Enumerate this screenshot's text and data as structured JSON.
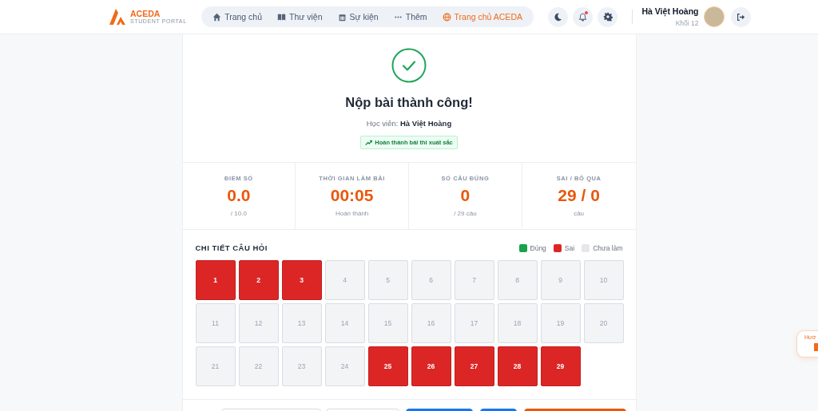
{
  "header": {
    "brand": "ACEDA",
    "subtitle": "STUDENT PORTAL",
    "nav": [
      {
        "label": "Trang chủ",
        "kind": "home",
        "selected": false
      },
      {
        "label": "Thư viện",
        "kind": "book",
        "selected": false
      },
      {
        "label": "Sự kiện",
        "kind": "calendar",
        "selected": false
      },
      {
        "label": "Thêm",
        "kind": "dots",
        "selected": false
      },
      {
        "label": "Trang chủ ACEDA",
        "kind": "globe",
        "selected": true
      }
    ],
    "notification_dot": true,
    "user": {
      "name": "Hà Việt Hoàng",
      "grade": "Khối 12"
    }
  },
  "result": {
    "title": "Nộp bài thành công!",
    "student_label": "Học viên:",
    "student_name": "Hà Việt Hoàng",
    "badge": "Hoàn thành bài thi xuất sắc"
  },
  "stats": [
    {
      "label": "ĐIỂM SỐ",
      "value": "0.0",
      "note": "/ 10.0"
    },
    {
      "label": "THỜI GIAN LÀM BÀI",
      "value": "00:05",
      "note": "Hoàn thành"
    },
    {
      "label": "SỐ CÂU ĐÚNG",
      "value": "0",
      "note": "/ 29 câu"
    },
    {
      "label": "SAI / BỎ QUA",
      "value": "29 / 0",
      "note": "câu"
    }
  ],
  "details": {
    "title": "CHI TIẾT CÂU HỎI",
    "legend": [
      {
        "label": "Đúng",
        "color": "#16a34a"
      },
      {
        "label": "Sai",
        "color": "#dc2626"
      },
      {
        "label": "Chưa làm",
        "color": "#e5e7eb"
      }
    ],
    "questions": [
      {
        "number": "1",
        "kind": "wrong"
      },
      {
        "number": "2",
        "kind": "wrong"
      },
      {
        "number": "3",
        "kind": "wrong"
      },
      {
        "number": "4",
        "kind": "unanswered"
      },
      {
        "number": "5",
        "kind": "unanswered"
      },
      {
        "number": "6",
        "kind": "unanswered"
      },
      {
        "number": "7",
        "kind": "unanswered"
      },
      {
        "number": "8",
        "kind": "unanswered"
      },
      {
        "number": "9",
        "kind": "unanswered"
      },
      {
        "number": "10",
        "kind": "unanswered"
      },
      {
        "number": "11",
        "kind": "unanswered"
      },
      {
        "number": "12",
        "kind": "unanswered"
      },
      {
        "number": "13",
        "kind": "unanswered"
      },
      {
        "number": "14",
        "kind": "unanswered"
      },
      {
        "number": "15",
        "kind": "unanswered"
      },
      {
        "number": "16",
        "kind": "unanswered"
      },
      {
        "number": "17",
        "kind": "unanswered"
      },
      {
        "number": "18",
        "kind": "unanswered"
      },
      {
        "number": "19",
        "kind": "unanswered"
      },
      {
        "number": "20",
        "kind": "unanswered"
      },
      {
        "number": "21",
        "kind": "unanswered"
      },
      {
        "number": "22",
        "kind": "unanswered"
      },
      {
        "number": "23",
        "kind": "unanswered"
      },
      {
        "number": "24",
        "kind": "unanswered"
      },
      {
        "number": "25",
        "kind": "wrong"
      },
      {
        "number": "26",
        "kind": "wrong"
      },
      {
        "number": "27",
        "kind": "wrong"
      },
      {
        "number": "28",
        "kind": "wrong"
      },
      {
        "number": "29",
        "kind": "wrong"
      }
    ]
  },
  "actions": [
    {
      "kind": "outline"
    },
    {
      "kind": "outline"
    },
    {
      "kind": "primary"
    },
    {
      "kind": "primary"
    },
    {
      "kind": "accent"
    }
  ],
  "floating_help": {
    "label": "Hướ"
  }
}
